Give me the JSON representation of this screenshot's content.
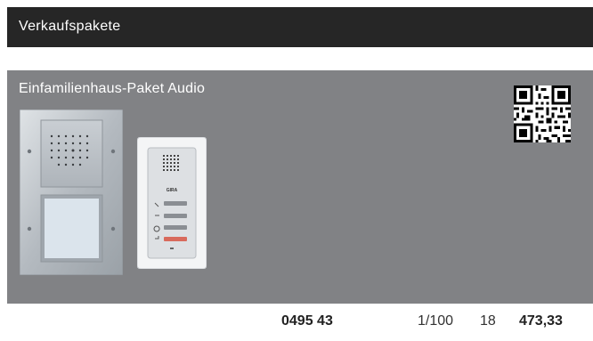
{
  "header": {
    "title": "Verkaufspakete"
  },
  "product": {
    "title": "Einfamilienhaus-Paket Audio",
    "brand_label": "GIRA",
    "article_number": "0495 43",
    "pack": "1/100",
    "group": "18",
    "price": "473,33"
  },
  "icons": [
    "qr-code-icon",
    "door-station-image",
    "home-station-image"
  ]
}
